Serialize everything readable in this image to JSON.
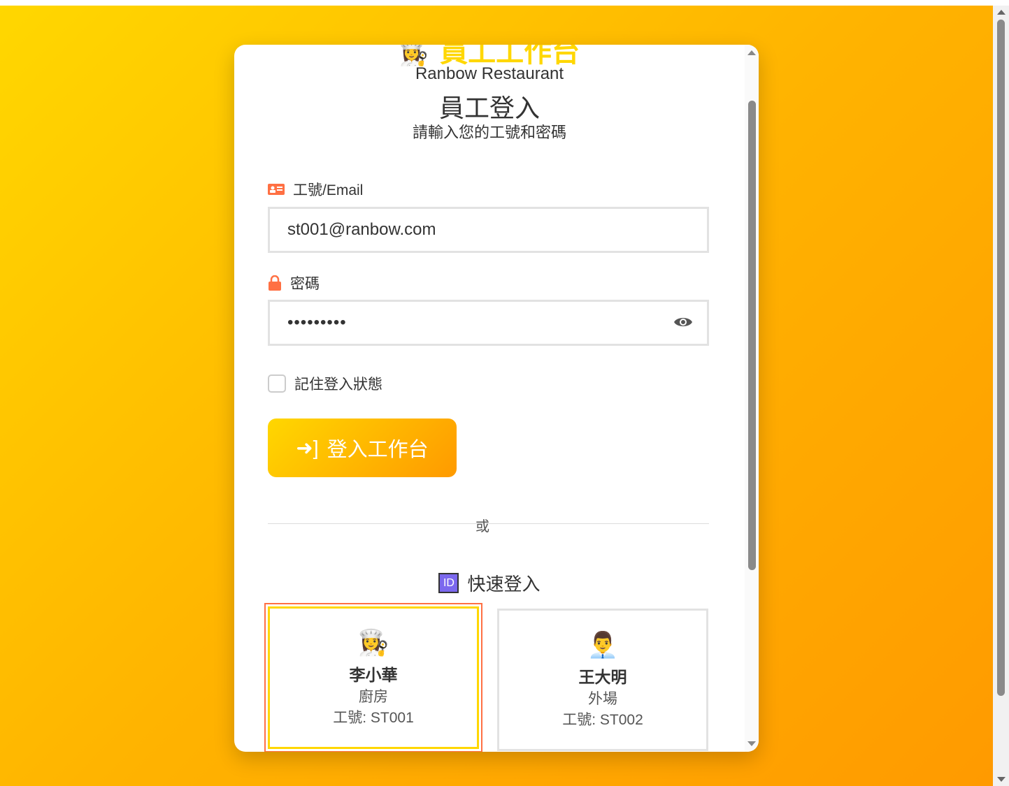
{
  "brand": {
    "title": "員工工作台",
    "restaurant": "Ranbow Restaurant"
  },
  "login": {
    "heading": "員工登入",
    "subtitle": "請輸入您的工號和密碼",
    "id_label": "工號/Email",
    "id_value": "st001@ranbow.com",
    "password_label": "密碼",
    "password_value": "•••••••••",
    "remember_label": "記住登入狀態",
    "submit_label": "登入工作台",
    "or": "或"
  },
  "quick": {
    "title": "快速登入",
    "id_badge": "ID",
    "employees": [
      {
        "name": "李小華",
        "dept": "廚房",
        "id": "工號: ST001",
        "avatar": "👩‍🍳",
        "selected": true
      },
      {
        "name": "王大明",
        "dept": "外場",
        "id": "工號: ST002",
        "avatar": "👨‍💼",
        "selected": false
      }
    ]
  },
  "colors": {
    "accent": "#ffd700",
    "accent2": "#ff9a00",
    "icon": "#ff7043"
  }
}
